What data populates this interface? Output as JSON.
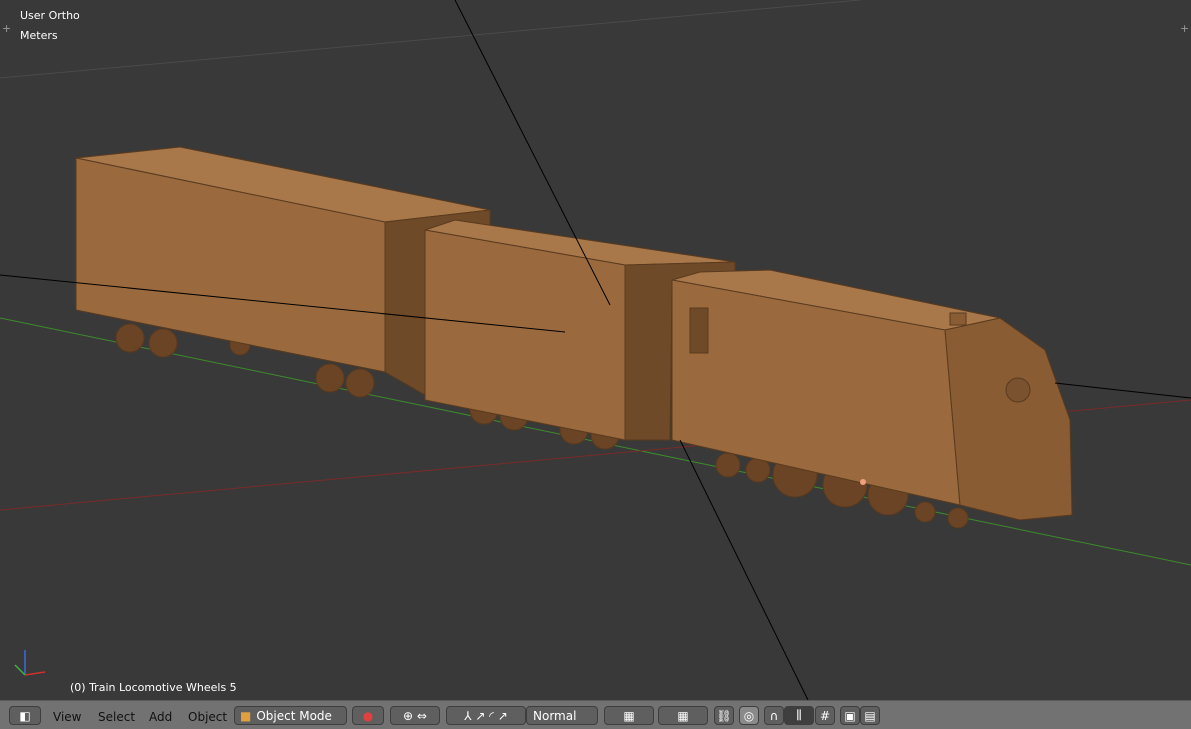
{
  "viewport": {
    "view_name": "User Ortho",
    "units": "Meters",
    "active_object": "(0) Train Locomotive Wheels 5"
  },
  "header": {
    "menus": [
      "View",
      "Select",
      "Add",
      "Object"
    ],
    "mode": "Object Mode",
    "pivot_orientation": "Normal"
  },
  "colors": {
    "background": "#393939",
    "header": "#727272",
    "wood": "#9a6a3e",
    "x_axis": "#8a2a2a",
    "y_axis": "#3a8a2a"
  }
}
